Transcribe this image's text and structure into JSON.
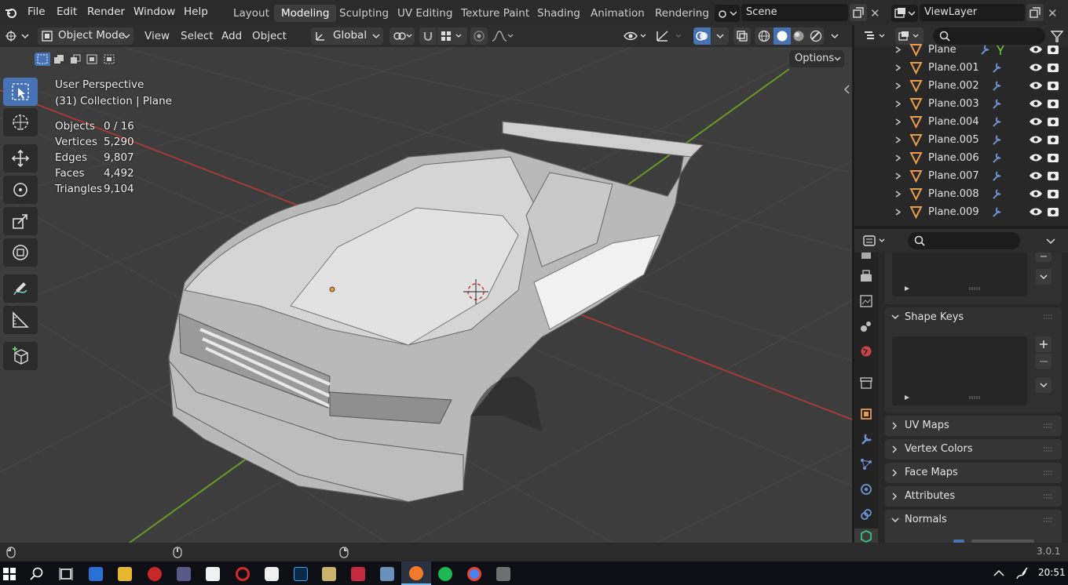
{
  "app": {
    "version": "3.0.1"
  },
  "menus": [
    "File",
    "Edit",
    "Render",
    "Window",
    "Help"
  ],
  "workspaces": [
    {
      "label": "Layout",
      "active": false
    },
    {
      "label": "Modeling",
      "active": true
    },
    {
      "label": "Sculpting",
      "active": false
    },
    {
      "label": "UV Editing",
      "active": false
    },
    {
      "label": "Texture Paint",
      "active": false
    },
    {
      "label": "Shading",
      "active": false
    },
    {
      "label": "Animation",
      "active": false
    },
    {
      "label": "Rendering",
      "active": false
    }
  ],
  "scene": {
    "name": "Scene"
  },
  "view_layer": {
    "name": "ViewLayer"
  },
  "viewport_header": {
    "mode": "Object Mode",
    "menus": [
      "View",
      "Select",
      "Add",
      "Object"
    ],
    "transform_orientation": "Global",
    "options_label": "Options"
  },
  "overlay": {
    "view_name": "User Perspective",
    "collection": "(31) Collection | Plane",
    "stats": [
      {
        "label": "Objects",
        "value": "0 / 16"
      },
      {
        "label": "Vertices",
        "value": "5,290"
      },
      {
        "label": "Edges",
        "value": "9,807"
      },
      {
        "label": "Faces",
        "value": "4,492"
      },
      {
        "label": "Triangles",
        "value": "9,104"
      }
    ]
  },
  "tools": [
    {
      "name": "select-box-tool",
      "icon": "cursor-select-icon",
      "selected": true
    },
    {
      "name": "cursor-tool",
      "icon": "3d-cursor-icon"
    },
    {
      "name": "move-tool",
      "icon": "move-arrows-icon"
    },
    {
      "name": "rotate-tool",
      "icon": "rotate-icon"
    },
    {
      "name": "scale-tool",
      "icon": "scale-icon"
    },
    {
      "name": "transform-tool",
      "icon": "transform-icon"
    },
    {
      "name": "annotate-tool",
      "icon": "annotate-pen-icon"
    },
    {
      "name": "measure-tool",
      "icon": "ruler-icon"
    },
    {
      "name": "add-cube-tool",
      "icon": "add-cube-icon"
    }
  ],
  "outliner": {
    "items": [
      "Plane",
      "Plane.001",
      "Plane.002",
      "Plane.003",
      "Plane.004",
      "Plane.005",
      "Plane.006",
      "Plane.007",
      "Plane.008",
      "Plane.009"
    ]
  },
  "properties": {
    "panels": [
      {
        "label": "Shape Keys",
        "expanded": true
      },
      {
        "label": "UV Maps",
        "expanded": false
      },
      {
        "label": "Vertex Colors",
        "expanded": false
      },
      {
        "label": "Face Maps",
        "expanded": false
      },
      {
        "label": "Attributes",
        "expanded": false
      },
      {
        "label": "Normals",
        "expanded": true
      }
    ]
  },
  "taskbar": {
    "time": "20:51"
  },
  "colors": {
    "accent": "#4772b3",
    "x_axis": "#a33a3a",
    "y_axis": "#6a9a26",
    "object_origin": "#f29a2c",
    "mesh_icon": "#e89b49",
    "modifier_icon": "#6f92d4"
  }
}
